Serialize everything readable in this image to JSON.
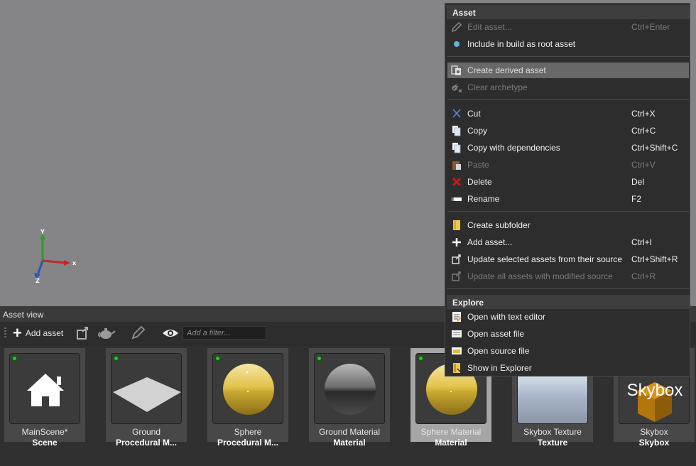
{
  "viewport": {
    "axis_x": "x",
    "axis_y": "Y",
    "axis_z": "Z"
  },
  "asset_view": {
    "title": "Asset view",
    "toolbar": {
      "add_label": "Add asset",
      "filter_placeholder": "Add a filter..."
    },
    "tiles": [
      {
        "name": "MainScene*",
        "type": "Scene",
        "thumbnail": "home-icon",
        "status": "green"
      },
      {
        "name": "Ground",
        "type": "Procedural M...",
        "thumbnail": "plane",
        "status": "green"
      },
      {
        "name": "Sphere",
        "type": "Procedural M...",
        "thumbnail": "gold-sphere",
        "status": "green"
      },
      {
        "name": "Ground Material",
        "type": "Material",
        "thumbnail": "gray-sphere",
        "status": "green"
      },
      {
        "name": "Sphere Material",
        "type": "Material",
        "thumbnail": "gold-sphere",
        "status": "green",
        "selected": true
      },
      {
        "name": "Skybox Texture",
        "type": "Texture",
        "thumbnail": "sky-gradient"
      },
      {
        "name": "Skybox",
        "type": "Skybox",
        "thumbnail": "skybox",
        "thumb_text": "Skybox"
      }
    ]
  },
  "context_menu": {
    "sections": [
      {
        "header": "Asset",
        "items": [
          {
            "label": "Edit asset...",
            "shortcut": "Ctrl+Enter",
            "icon": "pencil-icon",
            "disabled": true
          },
          {
            "label": "Include in build as root asset",
            "shortcut": "",
            "icon": "dot-icon"
          },
          {
            "separator": true
          },
          {
            "label": "Create derived asset",
            "shortcut": "",
            "icon": "derive-icon",
            "highlighted": true
          },
          {
            "label": "Clear archetype",
            "shortcut": "",
            "icon": "unlink-icon",
            "disabled": true
          },
          {
            "separator": true
          },
          {
            "label": "Cut",
            "shortcut": "Ctrl+X",
            "icon": "scissors-icon"
          },
          {
            "label": "Copy",
            "shortcut": "Ctrl+C",
            "icon": "copy-icon"
          },
          {
            "label": "Copy with dependencies",
            "shortcut": "Ctrl+Shift+C",
            "icon": "copy-deps-icon"
          },
          {
            "label": "Paste",
            "shortcut": "Ctrl+V",
            "icon": "paste-icon",
            "disabled": true
          },
          {
            "label": "Delete",
            "shortcut": "Del",
            "icon": "delete-icon"
          },
          {
            "label": "Rename",
            "shortcut": "F2",
            "icon": "rename-icon"
          },
          {
            "separator": true
          },
          {
            "label": "Create subfolder",
            "shortcut": "",
            "icon": "folder-icon"
          },
          {
            "label": "Add asset...",
            "shortcut": "Ctrl+I",
            "icon": "plus-icon"
          },
          {
            "label": "Update selected assets from their source",
            "shortcut": "Ctrl+Shift+R",
            "icon": "update-icon"
          },
          {
            "label": "Update all assets with modified source",
            "shortcut": "Ctrl+R",
            "icon": "update-icon",
            "disabled": true
          },
          {
            "separator": true
          }
        ]
      },
      {
        "header": "Explore",
        "items": [
          {
            "label": "Open with text editor",
            "shortcut": "",
            "icon": "text-editor-icon"
          },
          {
            "label": "Open asset file",
            "shortcut": "",
            "icon": "asset-file-icon"
          },
          {
            "label": "Open source file",
            "shortcut": "",
            "icon": "source-file-icon"
          },
          {
            "label": "Show in Explorer",
            "shortcut": "",
            "icon": "explorer-icon"
          }
        ]
      }
    ]
  },
  "colors": {
    "gold": "#e2c34a",
    "highlight": "#686868",
    "status_green": "#2cc52c",
    "viewport": "#858587"
  }
}
